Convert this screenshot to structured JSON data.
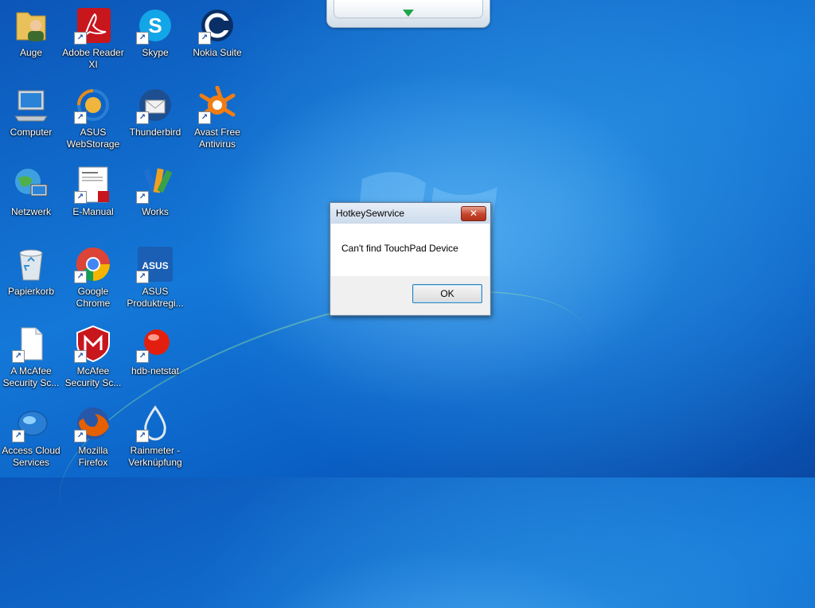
{
  "desktop": {
    "icons": [
      {
        "label": "Auge",
        "icon": "user-folder-icon"
      },
      {
        "label": "Adobe Reader\nXI",
        "icon": "adobe-reader-icon"
      },
      {
        "label": "Skype",
        "icon": "skype-icon"
      },
      {
        "label": "Nokia Suite",
        "icon": "nokia-suite-icon"
      },
      {
        "label": "Computer",
        "icon": "computer-icon"
      },
      {
        "label": "ASUS\nWebStorage",
        "icon": "asus-webstorage-icon"
      },
      {
        "label": "Thunderbird",
        "icon": "thunderbird-icon"
      },
      {
        "label": "Avast Free\nAntivirus",
        "icon": "avast-icon"
      },
      {
        "label": "Netzwerk",
        "icon": "network-icon"
      },
      {
        "label": "E-Manual",
        "icon": "e-manual-icon"
      },
      {
        "label": "Works",
        "icon": "works-icon"
      },
      {
        "label": "Papierkorb",
        "icon": "recycle-bin-icon"
      },
      {
        "label": "Google\nChrome",
        "icon": "chrome-icon"
      },
      {
        "label": "ASUS\nProduktregi...",
        "icon": "asus-registration-icon"
      },
      {
        "label": "A McAfee\nSecurity Sc...",
        "icon": "document-icon"
      },
      {
        "label": "McAfee\nSecurity Sc...",
        "icon": "mcafee-icon"
      },
      {
        "label": "hdb-netstat",
        "icon": "red-ball-icon"
      },
      {
        "label": "Access Cloud\nServices",
        "icon": "cloud-mouse-icon"
      },
      {
        "label": "Mozilla\nFirefox",
        "icon": "firefox-icon"
      },
      {
        "label": "Rainmeter -\nVerknüpfung",
        "icon": "rainmeter-icon"
      }
    ]
  },
  "dialog": {
    "title": "HotkeySewrvice",
    "message": "Can't find TouchPad Device",
    "ok_label": "OK",
    "close_symbol": "✕"
  },
  "colors": {
    "desktop_background": "#1478d8",
    "dialog_close": "#c6442b"
  }
}
